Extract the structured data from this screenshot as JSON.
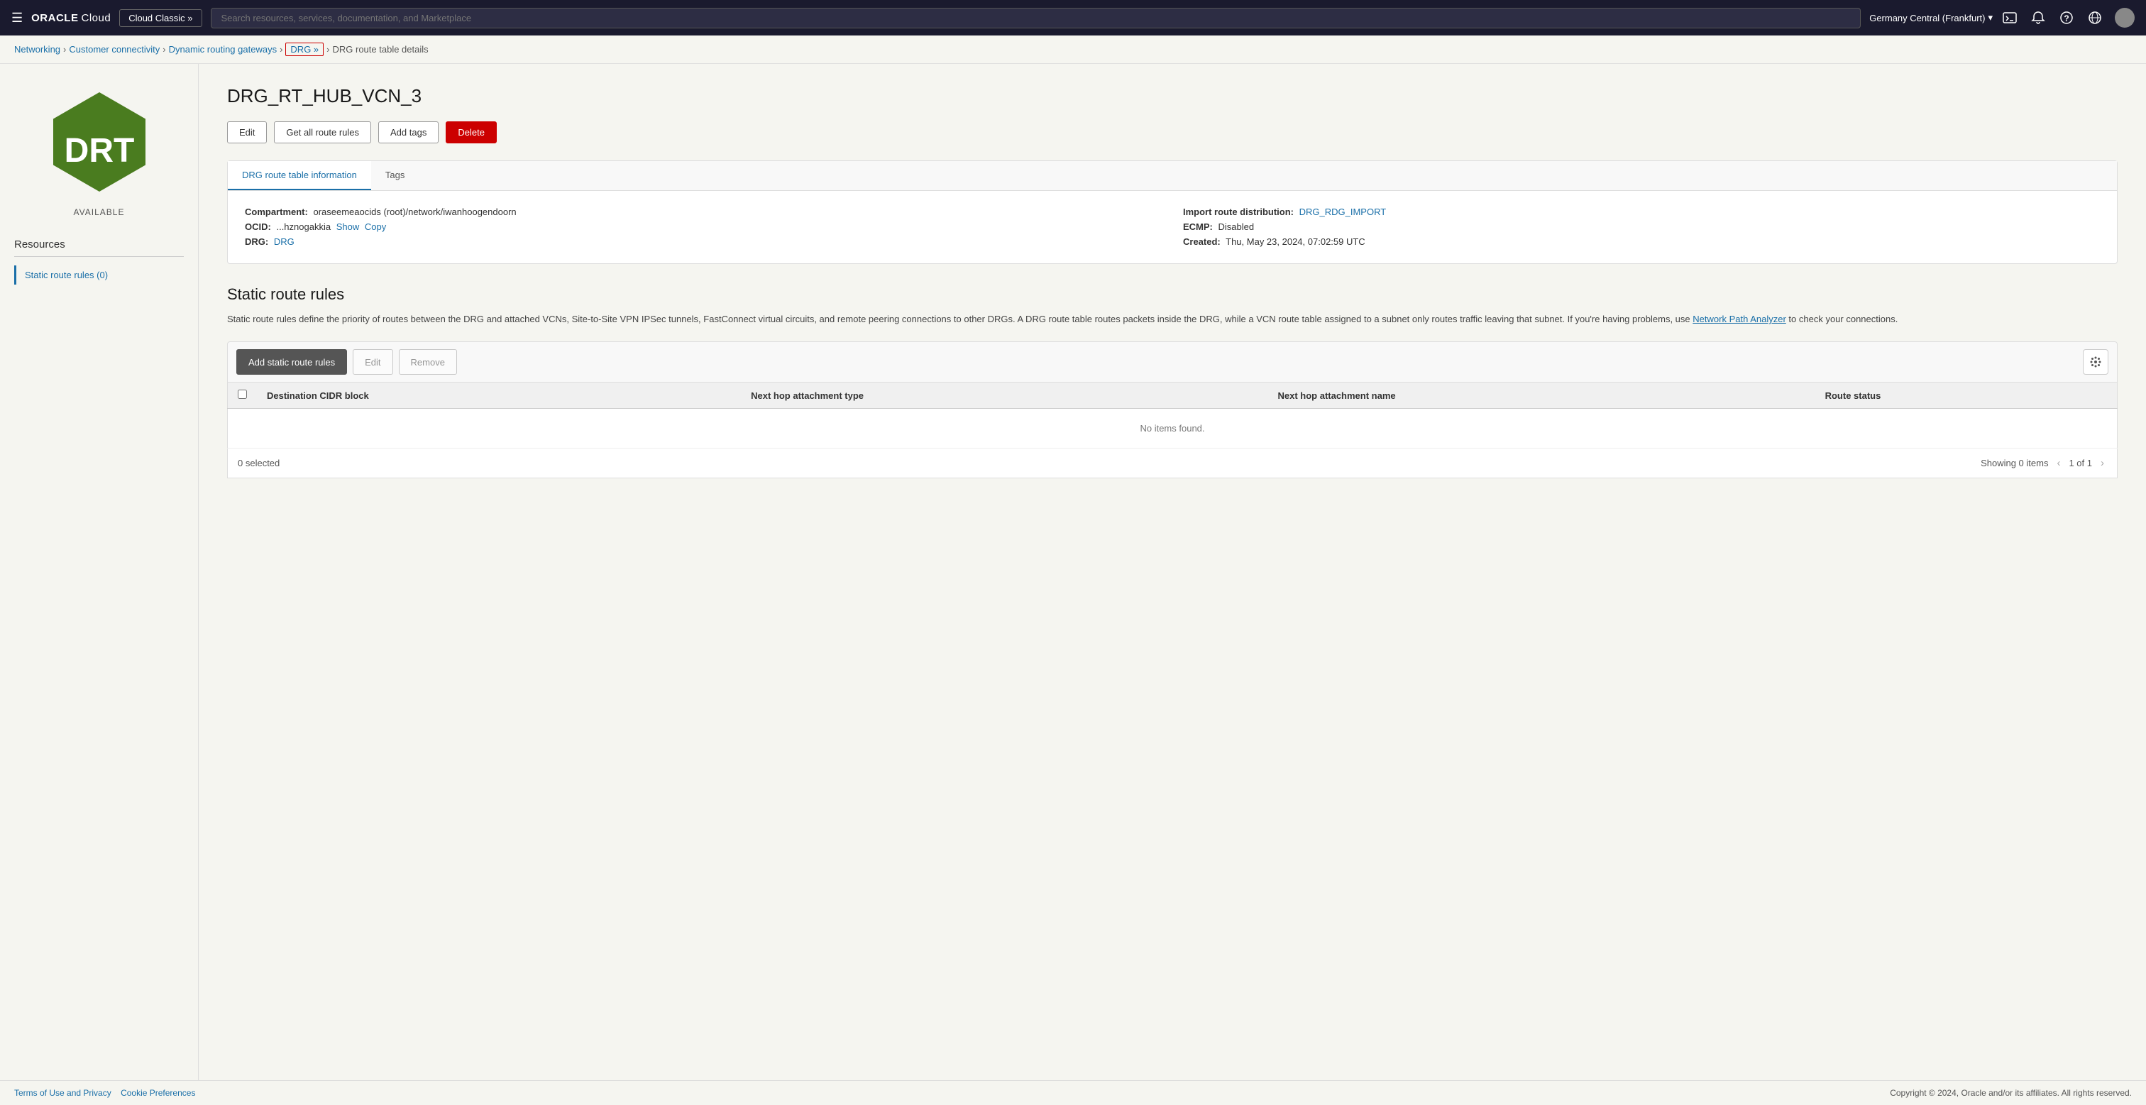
{
  "topnav": {
    "logo": "ORACLE Cloud",
    "cloud_classic_label": "Cloud Classic »",
    "search_placeholder": "Search resources, services, documentation, and Marketplace",
    "region": "Germany Central (Frankfurt)",
    "region_chevron": "▾"
  },
  "breadcrumb": {
    "networking": "Networking",
    "customer_connectivity": "Customer connectivity",
    "dynamic_routing_gateways": "Dynamic routing gateways",
    "drg": "DRG »",
    "current": "DRG route table details"
  },
  "page": {
    "title": "DRG_RT_HUB_VCN_3",
    "status": "AVAILABLE",
    "icon_text": "DRT"
  },
  "actions": {
    "edit": "Edit",
    "get_all_route_rules": "Get all route rules",
    "add_tags": "Add tags",
    "delete": "Delete"
  },
  "tabs": {
    "info_tab": "DRG route table information",
    "tags_tab": "Tags"
  },
  "info": {
    "compartment_label": "Compartment:",
    "compartment_value": "oraseemeaocids (root)/network/iwanhoogendoorn",
    "import_route_label": "Import route distribution:",
    "import_route_link": "DRG_RDG_IMPORT",
    "ocid_label": "OCID:",
    "ocid_value": "...hznogakkia",
    "show": "Show",
    "copy": "Copy",
    "ecmp_label": "ECMP:",
    "ecmp_value": "Disabled",
    "drg_label": "DRG:",
    "drg_link": "DRG",
    "created_label": "Created:",
    "created_value": "Thu, May 23, 2024, 07:02:59 UTC"
  },
  "static_rules": {
    "title": "Static route rules",
    "description": "Static route rules define the priority of routes between the DRG and attached VCNs, Site-to-Site VPN IPSec tunnels, FastConnect virtual circuits, and remote peering connections to other DRGs. A DRG route table routes packets inside the DRG, while a VCN route table assigned to a subnet only routes traffic leaving that subnet. If you're having problems, use",
    "network_path_link": "Network Path Analyzer",
    "description_end": "to check your connections."
  },
  "table_toolbar": {
    "add_static": "Add static route rules",
    "edit": "Edit",
    "remove": "Remove"
  },
  "table": {
    "columns": {
      "destination_cidr": "Destination CIDR block",
      "next_hop_type": "Next hop attachment type",
      "next_hop_name": "Next hop attachment name",
      "route_status": "Route status"
    },
    "no_items": "No items found.",
    "selected_count": "0 selected",
    "showing": "Showing 0 items",
    "pagination": "1 of 1"
  },
  "sidebar": {
    "resources_title": "Resources",
    "items": [
      {
        "label": "Static route rules (0)",
        "active": true
      }
    ]
  },
  "footer": {
    "terms": "Terms of Use and Privacy",
    "cookies": "Cookie Preferences",
    "copyright": "Copyright © 2024, Oracle and/or its affiliates. All rights reserved."
  }
}
